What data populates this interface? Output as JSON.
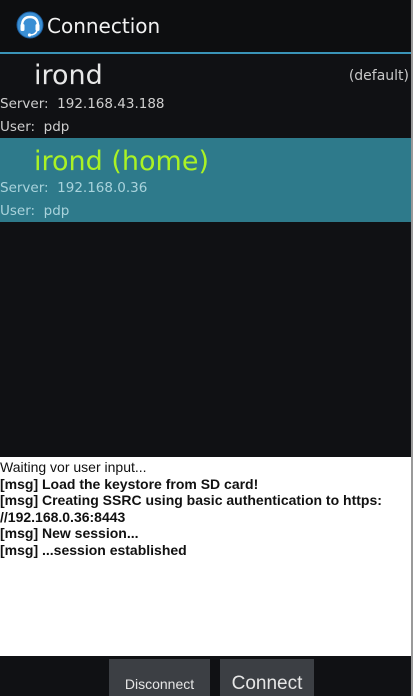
{
  "app": {
    "title": "Connection",
    "icon": "headset-app-icon",
    "accent_color": "#3a94b8"
  },
  "connections": [
    {
      "name": "irond",
      "tag": "(default)",
      "server_line": "Server:  192.168.43.188",
      "user_line": "User:  pdp",
      "selected": false
    },
    {
      "name": "irond (home)",
      "tag": "",
      "server_line": "Server:  192.168.0.36",
      "user_line": "User:  pdp",
      "selected": true,
      "highlight_color": "#2e7a8b",
      "name_color": "#aaf224"
    }
  ],
  "log": {
    "lines": [
      "Waiting vor user input...",
      "[msg] Load the keystore from SD card!",
      "[msg] Creating SSRC using basic authentication to https:",
      "//192.168.0.36:8443",
      "[msg] New session...",
      "[msg] ...session established"
    ]
  },
  "buttons": {
    "disconnect": "Disconnect",
    "connect": "Connect"
  }
}
